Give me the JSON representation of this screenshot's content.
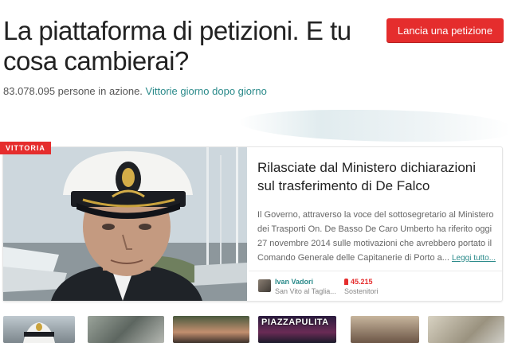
{
  "header": {
    "headline": "La piattaforma di petizioni. E tu cosa cambierai?",
    "launch_button": "Lancia una petizione",
    "people_count": "83.078.095 persone in azione.",
    "victories_link": "Vittorie giorno dopo giorno"
  },
  "featured": {
    "badge": "VITTORIA",
    "title": "Rilasciate dal Ministero dichiarazioni sul trasferimento di De Falco",
    "text": "Il Governo, attraverso la voce del sottosegretario al Ministero dei Trasporti On. De Basso De Caro Umberto ha riferito oggi 27 novembre 2014 sulle motivazioni che avrebbero portato il Comando Generale delle Capitanerie di Porto a...",
    "read_more": "Leggi tutto...",
    "author_name": "Ivan Vadori",
    "author_location": "San Vito al Taglia...",
    "supporters_count": "45.215",
    "supporters_label": "Sostenitori"
  },
  "thumbnails": {
    "tag_3": "PIAZZAPULITA"
  }
}
